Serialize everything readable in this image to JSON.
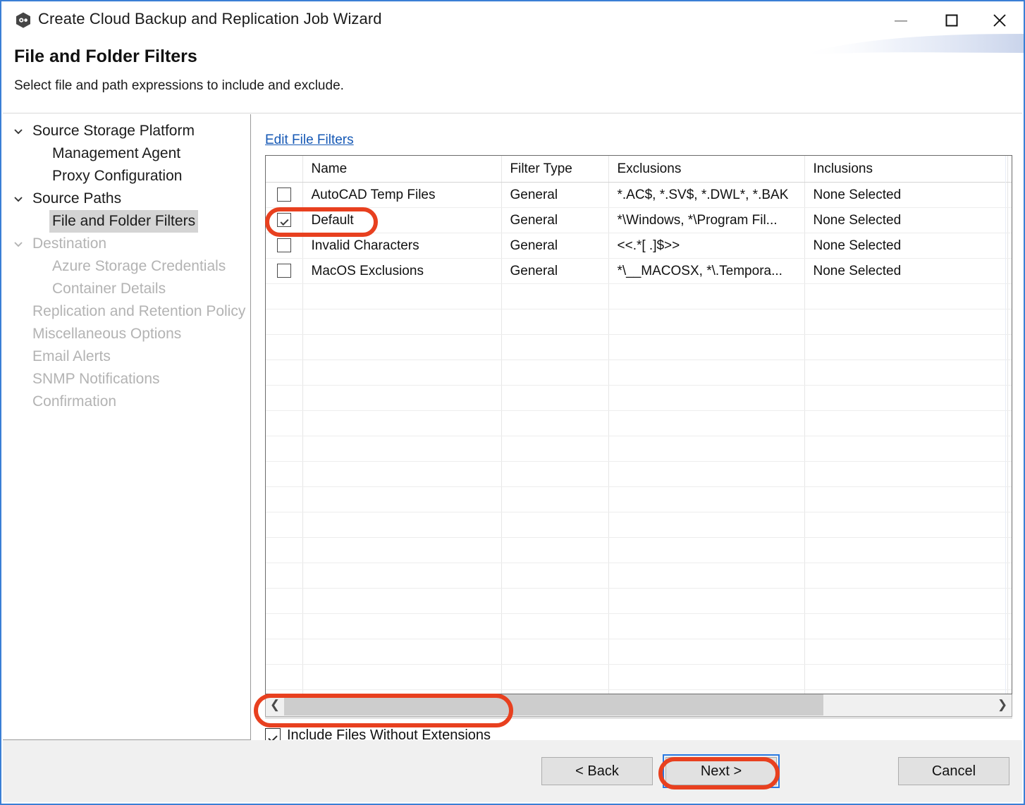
{
  "window": {
    "title": "Create Cloud Backup and Replication Job Wizard",
    "icon": "app-hexagon-icon",
    "controls": {
      "minimize": "minimize-icon",
      "maximize": "maximize-icon",
      "close": "close-icon"
    },
    "border_color": "#3a7fd5"
  },
  "header": {
    "page_title": "File and Folder Filters",
    "page_subtitle": "Select file and path expressions to include and exclude."
  },
  "sidebar": {
    "items": [
      {
        "label": "Source Storage Platform",
        "level": 0,
        "chevron": true,
        "disabled": false,
        "selected": false
      },
      {
        "label": "Management Agent",
        "level": 1,
        "chevron": false,
        "disabled": false,
        "selected": false
      },
      {
        "label": "Proxy Configuration",
        "level": 1,
        "chevron": false,
        "disabled": false,
        "selected": false
      },
      {
        "label": "Source Paths",
        "level": 0,
        "chevron": true,
        "disabled": false,
        "selected": false
      },
      {
        "label": "File and Folder Filters",
        "level": 1,
        "chevron": false,
        "disabled": false,
        "selected": true
      },
      {
        "label": "Destination",
        "level": 0,
        "chevron": true,
        "disabled": true,
        "selected": false
      },
      {
        "label": "Azure Storage Credentials",
        "level": 1,
        "chevron": false,
        "disabled": true,
        "selected": false
      },
      {
        "label": "Container Details",
        "level": 1,
        "chevron": false,
        "disabled": true,
        "selected": false
      },
      {
        "label": "Replication and Retention Policy",
        "level": 0,
        "chevron": false,
        "disabled": true,
        "selected": false
      },
      {
        "label": "Miscellaneous Options",
        "level": 0,
        "chevron": false,
        "disabled": true,
        "selected": false
      },
      {
        "label": "Email Alerts",
        "level": 0,
        "chevron": false,
        "disabled": true,
        "selected": false
      },
      {
        "label": "SNMP Notifications",
        "level": 0,
        "chevron": false,
        "disabled": true,
        "selected": false
      },
      {
        "label": "Confirmation",
        "level": 0,
        "chevron": false,
        "disabled": true,
        "selected": false
      }
    ]
  },
  "content": {
    "edit_link": "Edit File Filters",
    "table": {
      "columns": [
        "",
        "Name",
        "Filter Type",
        "Exclusions",
        "Inclusions"
      ],
      "rows": [
        {
          "checked": false,
          "name": "AutoCAD Temp Files",
          "filter_type": "General",
          "exclusions": "*.AC$, *.SV$, *.DWL*, *.BAK",
          "inclusions": "None Selected"
        },
        {
          "checked": true,
          "name": "Default",
          "filter_type": "General",
          "exclusions": "*\\Windows, *\\Program Fil...",
          "inclusions": "None Selected"
        },
        {
          "checked": false,
          "name": "Invalid Characters",
          "filter_type": "General",
          "exclusions": "<<.*[ .]$>>",
          "inclusions": "None Selected"
        },
        {
          "checked": false,
          "name": "MacOS Exclusions",
          "filter_type": "General",
          "exclusions": "*\\__MACOSX, *\\.Tempora...",
          "inclusions": "None Selected"
        }
      ],
      "empty_row_count": 18
    },
    "hscrollbar": {
      "left_arrow": "chevron-left-icon",
      "right_arrow": "chevron-right-icon",
      "thumb_percent": 76
    },
    "include_without_extensions": {
      "label": "Include Files Without Extensions",
      "checked": true
    }
  },
  "footer": {
    "back_label": "< Back",
    "next_label": "Next >",
    "cancel_label": "Cancel",
    "focused_button": "Next >"
  },
  "annotations": {
    "highlight_color": "#e8401f",
    "targets": [
      "Default row checkbox",
      "Include Files Without Extensions",
      "Next >"
    ]
  }
}
